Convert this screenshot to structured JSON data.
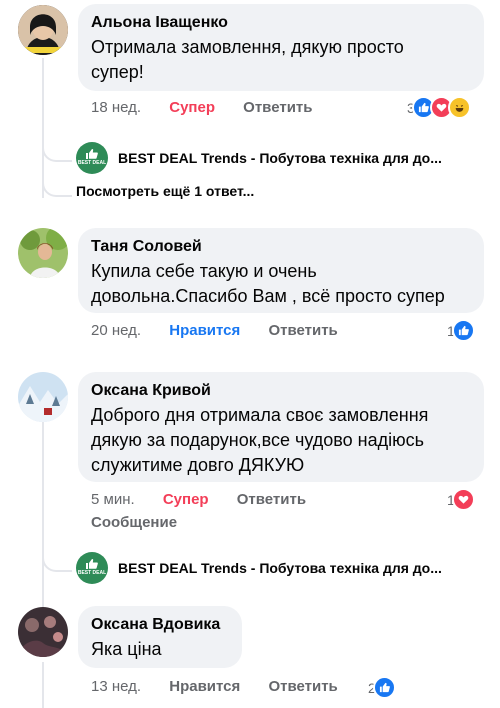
{
  "comments": [
    {
      "author": "Альона Іващенко",
      "text": "Отримала замовлення, дякую просто супер!",
      "time": "18 нед.",
      "reaction_label": "Супер",
      "reply_label": "Ответить",
      "reaction_count": "3",
      "reply_preview": {
        "author": "BEST DEAL Trends - Побутова техніка для до...",
        "avatar_text": "BEST DEAL"
      },
      "more_replies": "Посмотреть ещё 1 ответ..."
    },
    {
      "author": "Таня Соловей",
      "text": "Купила себе такую и очень довольна.Спасибо Вам , всё просто супер",
      "time": "20 нед.",
      "reaction_label": "Нравится",
      "reply_label": "Ответить",
      "reaction_count": "1"
    },
    {
      "author": "Оксана Кривой",
      "text": "Доброго дня отримала своє замовлення дякую за подарунок,все чудово надіюсь служитиме довго ДЯКУЮ",
      "time": "5 мин.",
      "reaction_label": "Супер",
      "reply_label": "Ответить",
      "message_label": "Сообщение",
      "reaction_count": "1",
      "reply_preview": {
        "author": "BEST DEAL Trends - Побутова техніка для до...",
        "avatar_text": "BEST DEAL"
      }
    },
    {
      "author": "Оксана Вдовика",
      "text": "Яка ціна",
      "time": "13 нед.",
      "reaction_label": "Нравится",
      "reply_label": "Ответить",
      "reaction_count": "2"
    }
  ],
  "colors": {
    "bubble": "#f0f2f5",
    "like_blue": "#1877f2",
    "love_red": "#f33e58",
    "meta_gray": "#65676b",
    "page_green": "#2e8b57"
  },
  "icons": [
    "like-icon",
    "love-icon",
    "haha-icon"
  ]
}
